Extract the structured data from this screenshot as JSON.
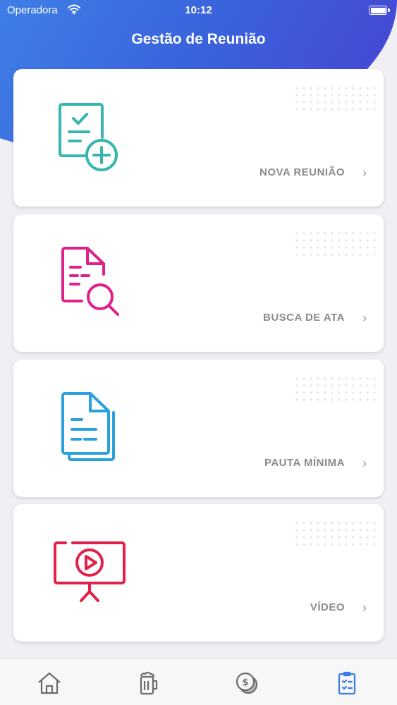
{
  "status_bar": {
    "carrier": "Operadora",
    "time": "10:12"
  },
  "header": {
    "title": "Gestão de Reunião"
  },
  "cards": [
    {
      "label": "NOVA REUNIÃO",
      "icon": "document-check-add-icon",
      "color": "#37b6b0"
    },
    {
      "label": "BUSCA DE ATA",
      "icon": "document-search-icon",
      "color": "#e0208c"
    },
    {
      "label": "PAUTA MÍNIMA",
      "icon": "documents-icon",
      "color": "#2aa0dd"
    },
    {
      "label": "VÍDEO",
      "icon": "video-presentation-icon",
      "color": "#e0224a"
    }
  ],
  "tab_bar": {
    "items": [
      {
        "icon": "home-icon",
        "active": false
      },
      {
        "icon": "beer-mug-icon",
        "active": false
      },
      {
        "icon": "coin-icon",
        "active": false
      },
      {
        "icon": "checklist-icon",
        "active": true
      }
    ],
    "active_color": "#3a7bea",
    "inactive_color": "#6b6b70"
  }
}
